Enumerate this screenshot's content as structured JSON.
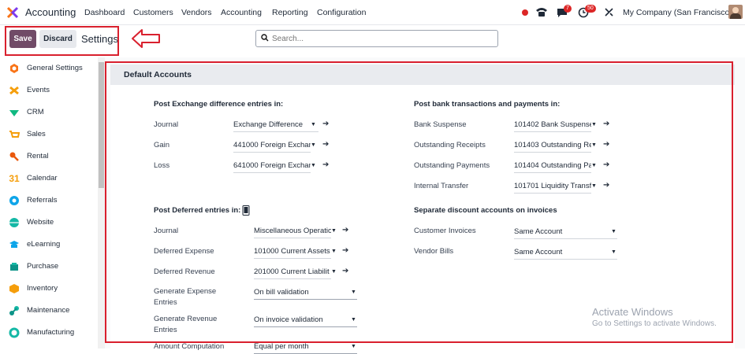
{
  "topbar": {
    "app_title": "Accounting",
    "nav": [
      "Dashboard",
      "Customers",
      "Vendors",
      "Accounting",
      "Reporting",
      "Configuration"
    ],
    "messages_count": "7",
    "activities_count": "50",
    "company": "My Company (San Francisco)"
  },
  "control": {
    "save_label": "Save",
    "discard_label": "Discard",
    "title": "Settings",
    "search_placeholder": "Search..."
  },
  "sidebar": {
    "items": [
      {
        "label": "General Settings",
        "icon": "general-settings-icon",
        "color": "#f97316"
      },
      {
        "label": "Events",
        "icon": "events-icon",
        "color": "#f59e0b"
      },
      {
        "label": "CRM",
        "icon": "crm-icon",
        "color": "#10b981"
      },
      {
        "label": "Sales",
        "icon": "sales-icon",
        "color": "#f59e0b"
      },
      {
        "label": "Rental",
        "icon": "rental-icon",
        "color": "#ea580c"
      },
      {
        "label": "Calendar",
        "icon": "calendar-icon",
        "color": "#f59e0b"
      },
      {
        "label": "Referrals",
        "icon": "referrals-icon",
        "color": "#0ea5e9"
      },
      {
        "label": "Website",
        "icon": "website-icon",
        "color": "#14b8a6"
      },
      {
        "label": "eLearning",
        "icon": "elearning-icon",
        "color": "#0ea5e9"
      },
      {
        "label": "Purchase",
        "icon": "purchase-icon",
        "color": "#0d9488"
      },
      {
        "label": "Inventory",
        "icon": "inventory-icon",
        "color": "#f59e0b"
      },
      {
        "label": "Maintenance",
        "icon": "maintenance-icon",
        "color": "#0d9488"
      },
      {
        "label": "Manufacturing",
        "icon": "manufacturing-icon",
        "color": "#14b8a6"
      }
    ]
  },
  "section": {
    "title": "Default Accounts",
    "exchange": {
      "title": "Post Exchange difference entries in:",
      "rows": [
        {
          "label": "Journal",
          "value": "Exchange Difference"
        },
        {
          "label": "Gain",
          "value": "441000 Foreign Exchan"
        },
        {
          "label": "Loss",
          "value": "641000 Foreign Exchan"
        }
      ]
    },
    "bank": {
      "title": "Post bank transactions and payments in:",
      "rows": [
        {
          "label": "Bank Suspense",
          "value": "101402 Bank Suspense"
        },
        {
          "label": "Outstanding Receipts",
          "value": "101403 Outstanding Re"
        },
        {
          "label": "Outstanding Payments",
          "value": "101404 Outstanding Pa"
        },
        {
          "label": "Internal Transfer",
          "value": "101701 Liquidity Transf"
        }
      ]
    },
    "deferred": {
      "title": "Post Deferred entries in:",
      "rows": [
        {
          "label": "Journal",
          "value": "Miscellaneous Operatio"
        },
        {
          "label": "Deferred Expense",
          "value": "101000 Current Assets"
        },
        {
          "label": "Deferred Revenue",
          "value": "201000 Current Liabilit"
        },
        {
          "label": "Generate Expense Entries",
          "value": "On bill validation"
        },
        {
          "label": "Generate Revenue Entries",
          "value": "On invoice validation"
        },
        {
          "label": "Amount Computation",
          "value": "Equal per month"
        }
      ]
    },
    "discount": {
      "title": "Separate discount accounts on invoices",
      "rows": [
        {
          "label": "Customer Invoices",
          "value": "Same Account"
        },
        {
          "label": "Vendor Bills",
          "value": "Same Account"
        }
      ]
    }
  },
  "watermark": {
    "line1": "Activate Windows",
    "line2": "Go to Settings to activate Windows."
  },
  "colors": {
    "brand": "#714b67",
    "highlight": "#d9202e"
  }
}
